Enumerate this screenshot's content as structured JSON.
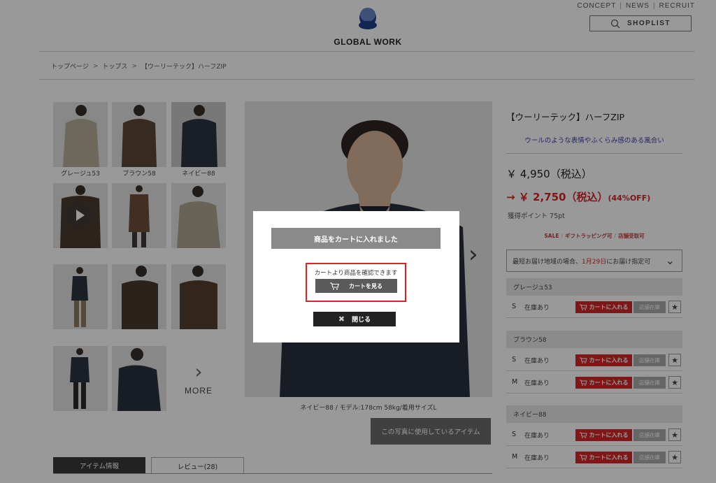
{
  "header": {
    "logo_text": "GLOBAL WORK",
    "top_links": [
      "CONCEPT",
      "NEWS",
      "RECRUIT"
    ],
    "shoplist_label": "SHOPLIST"
  },
  "breadcrumb": [
    "トップページ",
    "トップス",
    "【ウーリーテック】ハーフZIP"
  ],
  "thumbnails": {
    "labels": [
      "グレージュ53",
      "ブラウン58",
      "ネイビー88"
    ],
    "more_label": "MORE"
  },
  "main_image": {
    "caption": "ネイビー88 / モデル:178cm 58kg/着用サイズL",
    "used_items_label": "この写真に使用しているアイテム"
  },
  "tabs": [
    "アイテム情報",
    "レビュー(28)"
  ],
  "product": {
    "name": "【ウーリーテック】ハーフZIP",
    "subtitle": "ウールのような表情やふくらみ感のある風合い",
    "price_original": "￥ 4,950（税込）",
    "price_sale": "→ ￥ 2,750（税込）",
    "discount": "(44%OFF)",
    "points": "獲得ポイント 75pt",
    "tags": [
      "SALE",
      "ギフトラッピング可",
      "店舗受取可"
    ],
    "delivery_pre": "最短お届け地域の場合、",
    "delivery_date": "1月29日",
    "delivery_post": "にお届け指定可",
    "colors": [
      {
        "name": "グレージュ53",
        "rows": [
          {
            "size": "S",
            "stock": "在庫あり"
          }
        ]
      },
      {
        "name": "ブラウン58",
        "rows": [
          {
            "size": "S",
            "stock": "在庫あり"
          },
          {
            "size": "M",
            "stock": "在庫あり"
          }
        ]
      },
      {
        "name": "ネイビー88",
        "rows": [
          {
            "size": "S",
            "stock": "在庫あり"
          },
          {
            "size": "M",
            "stock": "在庫あり"
          }
        ]
      }
    ],
    "add_cart_label": "カートに入れる",
    "instore_label": "店舗在庫",
    "fav_icon": "star-icon"
  },
  "modal": {
    "title": "商品をカートに入れました",
    "message": "カートより商品を確認できます",
    "view_cart_label": "カートを見る",
    "close_label": "閉じる"
  },
  "colors": {
    "accent_red": "#d7262a",
    "overlay": "rgba(0,0,0,0.40)",
    "tab_active": "#3a3a3a"
  }
}
